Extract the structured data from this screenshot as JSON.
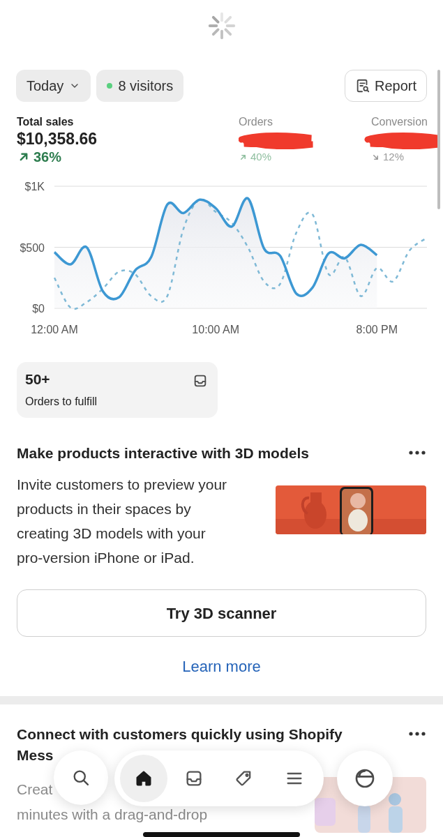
{
  "filters": {
    "period": {
      "label": "Today"
    },
    "visitors": {
      "label": "8 visitors",
      "color": "#5ad07f"
    }
  },
  "report_button": {
    "label": "Report"
  },
  "metrics": [
    {
      "label": "Total sales",
      "value": "$10,358.66",
      "change": "36%",
      "increase": true,
      "selected": true,
      "redacted": false
    },
    {
      "label": "Orders",
      "change": "40%",
      "increase": true,
      "selected": false,
      "redacted": true
    },
    {
      "label": "Conversion",
      "change": "12%",
      "increase": false,
      "selected": false,
      "redacted": true
    }
  ],
  "chart_data": {
    "type": "line",
    "x": [
      0,
      1,
      2,
      3,
      4,
      5,
      6,
      7,
      8,
      9,
      10,
      11,
      12,
      13,
      14,
      15,
      16,
      17,
      18,
      19,
      20,
      21,
      22,
      23
    ],
    "xlim": [
      0,
      23.1
    ],
    "xticks": [
      {
        "value": 0,
        "label": "12:00 AM"
      },
      {
        "value": 10,
        "label": "10:00 AM"
      },
      {
        "value": 20,
        "label": "8:00 PM"
      }
    ],
    "yticks": [
      {
        "value": 0,
        "label": "$0"
      },
      {
        "value": 500,
        "label": "$500"
      },
      {
        "value": 1000,
        "label": "$1K"
      }
    ],
    "ylim": [
      0,
      1000
    ],
    "series": [
      {
        "color": "#3d98d3",
        "line_style": "solid",
        "type": "area",
        "values": [
          460,
          360,
          500,
          140,
          90,
          310,
          420,
          850,
          780,
          890,
          820,
          670,
          900,
          490,
          430,
          120,
          170,
          450,
          410,
          520,
          435,
          null,
          null,
          null
        ]
      },
      {
        "color": "#7fb9d6",
        "line_style": "dashed",
        "type": "line",
        "values": [
          250,
          5,
          50,
          160,
          300,
          280,
          100,
          100,
          650,
          890,
          790,
          700,
          500,
          220,
          200,
          620,
          770,
          280,
          420,
          100,
          330,
          220,
          470,
          570
        ]
      }
    ]
  },
  "fulfill_card": {
    "count": "50+",
    "label": "Orders to fulfill"
  },
  "cards": [
    {
      "title": "Make products interactive with 3D models",
      "body_lines": [
        "Invite customers to preview your",
        "products in their spaces by",
        "creating 3D models with your",
        "pro-version iPhone or iPad."
      ],
      "image": {
        "kind": "picture"
      },
      "button": "Try 3D scanner",
      "link": "Learn more"
    },
    {
      "title": "Connect with customers quickly using Shopify Mess",
      "body_lines": [
        "Creat",
        "minutes with a drag-and-drop"
      ],
      "image": {
        "kind": "picture"
      }
    }
  ],
  "nav_tabs": [
    {
      "kind": "home",
      "selected": true
    },
    {
      "kind": "inbox",
      "selected": false
    },
    {
      "kind": "tag",
      "selected": false
    },
    {
      "kind": "menu",
      "selected": false
    }
  ]
}
